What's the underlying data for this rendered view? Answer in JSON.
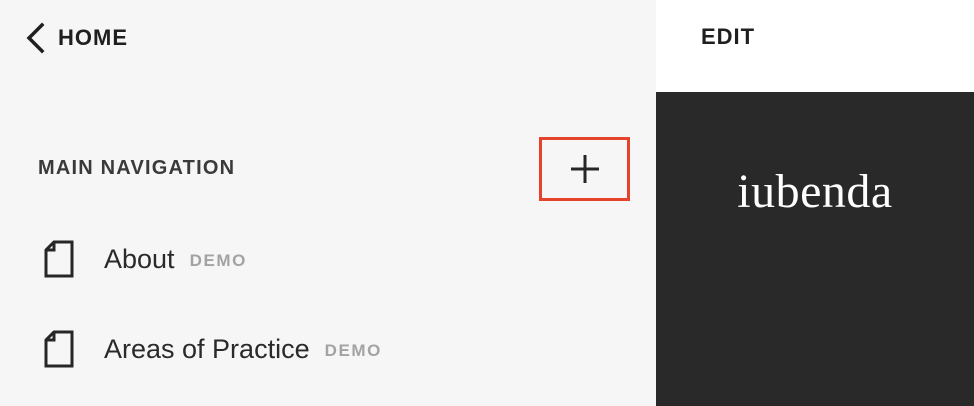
{
  "header": {
    "back_label": "HOME",
    "back_icon": "chevron-left-icon"
  },
  "navigation": {
    "section_title": "MAIN NAVIGATION",
    "add_icon": "plus-icon",
    "items": [
      {
        "label": "About",
        "badge": "DEMO",
        "icon": "page-icon"
      },
      {
        "label": "Areas of Practice",
        "badge": "DEMO",
        "icon": "page-icon"
      }
    ]
  },
  "preview": {
    "edit_label": "EDIT",
    "brand": "iubenda",
    "background_color": "#2a2929"
  },
  "colors": {
    "highlight": "#e5432c",
    "panel_bg": "#f6f6f6",
    "badge": "#a3a3a3"
  }
}
